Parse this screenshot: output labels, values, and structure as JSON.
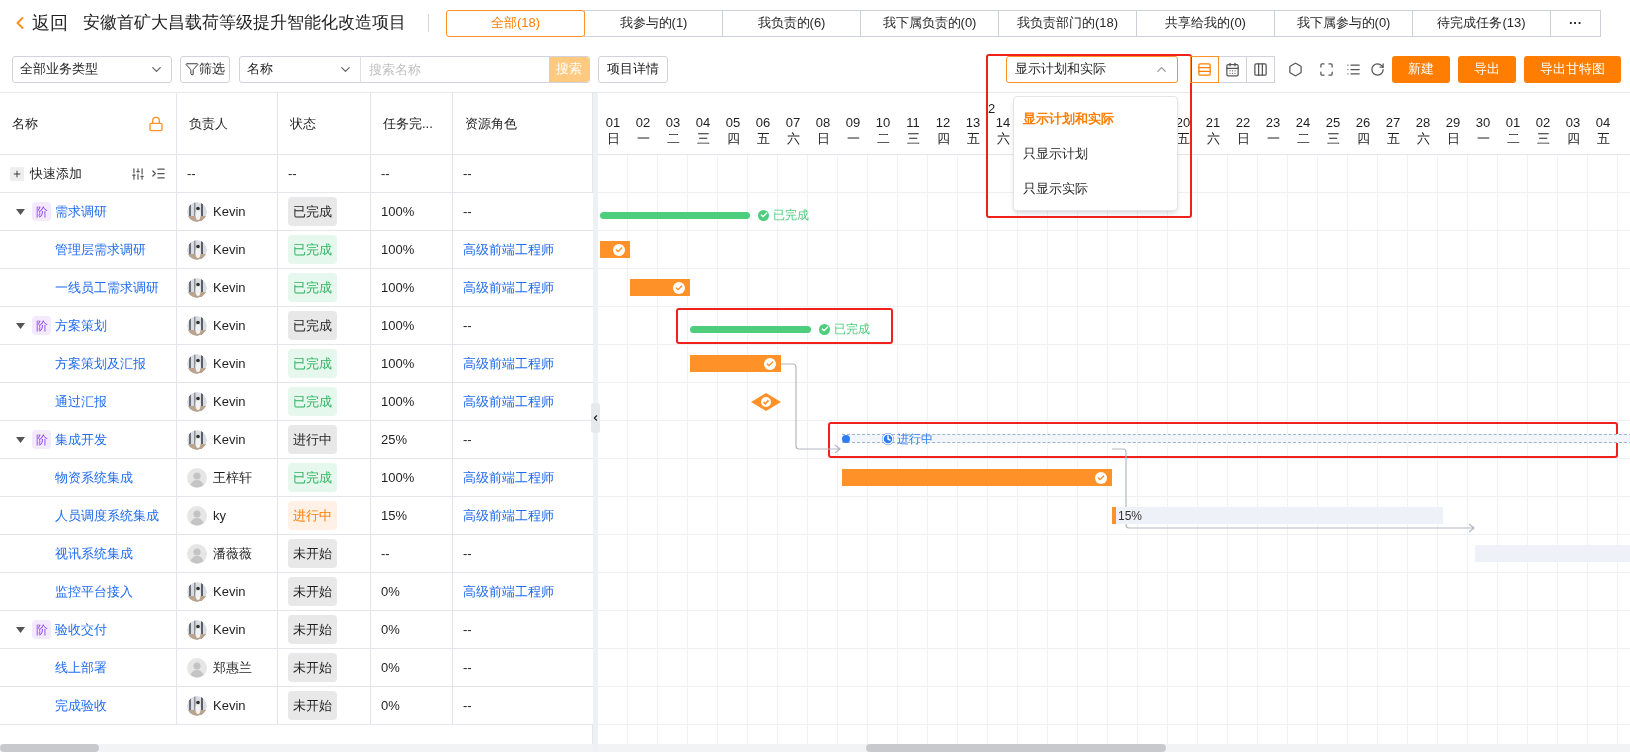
{
  "header": {
    "back": "返回",
    "title": "安徽首矿大昌载荷等级提升智能化改造项目",
    "tabs": [
      {
        "label": "全部(18)",
        "selected": true
      },
      {
        "label": "我参与的(1)",
        "selected": false
      },
      {
        "label": "我负责的(6)",
        "selected": false
      },
      {
        "label": "我下属负责的(0)",
        "selected": false
      },
      {
        "label": "我负责部门的(18)",
        "selected": false
      },
      {
        "label": "共享给我的(0)",
        "selected": false
      },
      {
        "label": "我下属参与的(0)",
        "selected": false
      },
      {
        "label": "待完成任务(13)",
        "selected": false
      },
      {
        "label": "···",
        "selected": false
      }
    ]
  },
  "toolbar": {
    "type_select": "全部业务类型",
    "filter": "筛选",
    "search_field_select": "名称",
    "search_placeholder": "搜索名称",
    "search_button": "搜索",
    "details": "项目详情",
    "view_select": {
      "value": "显示计划和实际",
      "expanded": true,
      "highlighted": true,
      "options": [
        {
          "label": "显示计划和实际",
          "selected": true
        },
        {
          "label": "只显示计划",
          "selected": false
        },
        {
          "label": "只显示实际",
          "selected": false
        }
      ]
    },
    "view_modes": [
      {
        "kind": "gantt",
        "selected": true
      },
      {
        "kind": "calendar",
        "selected": false
      },
      {
        "kind": "board",
        "selected": false
      }
    ],
    "actions": [
      "新建",
      "导出",
      "导出甘特图"
    ]
  },
  "table": {
    "columns": [
      "名称",
      "负责人",
      "状态",
      "任务完...",
      "资源角色"
    ],
    "quick_add": {
      "label": "快速添加",
      "cells": [
        "--",
        "--",
        "--",
        "--"
      ]
    },
    "rows": [
      {
        "kind": "phase",
        "expanded": true,
        "tag": "阶",
        "name": "需求调研",
        "owner": {
          "name": "Kevin"
        },
        "status": {
          "label": "已完成",
          "kind": "neutral"
        },
        "progress": "100%",
        "role": "--",
        "role_link": false
      },
      {
        "kind": "task",
        "name": "管理层需求调研",
        "owner": {
          "name": "Kevin"
        },
        "status": {
          "label": "已完成",
          "kind": "success"
        },
        "progress": "100%",
        "role": "高级前端工程师",
        "role_link": true
      },
      {
        "kind": "task",
        "name": "一线员工需求调研",
        "owner": {
          "name": "Kevin"
        },
        "status": {
          "label": "已完成",
          "kind": "success"
        },
        "progress": "100%",
        "role": "高级前端工程师",
        "role_link": true
      },
      {
        "kind": "phase",
        "expanded": true,
        "tag": "阶",
        "name": "方案策划",
        "owner": {
          "name": "Kevin"
        },
        "status": {
          "label": "已完成",
          "kind": "neutral"
        },
        "progress": "100%",
        "role": "--",
        "role_link": false
      },
      {
        "kind": "task",
        "name": "方案策划及汇报",
        "owner": {
          "name": "Kevin"
        },
        "status": {
          "label": "已完成",
          "kind": "success"
        },
        "progress": "100%",
        "role": "高级前端工程师",
        "role_link": true
      },
      {
        "kind": "task",
        "name": "通过汇报",
        "owner": {
          "name": "Kevin"
        },
        "status": {
          "label": "已完成",
          "kind": "success"
        },
        "progress": "100%",
        "role": "高级前端工程师",
        "role_link": true
      },
      {
        "kind": "phase",
        "expanded": true,
        "tag": "阶",
        "name": "集成开发",
        "owner": {
          "name": "Kevin"
        },
        "status": {
          "label": "进行中",
          "kind": "neutral"
        },
        "progress": "25%",
        "role": "--",
        "role_link": false
      },
      {
        "kind": "task",
        "name": "物资系统集成",
        "owner": {
          "name": "王梓轩",
          "kind": "default"
        },
        "status": {
          "label": "已完成",
          "kind": "success"
        },
        "progress": "100%",
        "role": "高级前端工程师",
        "role_link": true
      },
      {
        "kind": "task",
        "name": "人员调度系统集成",
        "owner": {
          "name": "ky",
          "kind": "default"
        },
        "status": {
          "label": "进行中",
          "kind": "warning"
        },
        "progress": "15%",
        "role": "高级前端工程师",
        "role_link": true
      },
      {
        "kind": "task",
        "name": "视讯系统集成",
        "owner": {
          "name": "潘薇薇",
          "kind": "default"
        },
        "status": {
          "label": "未开始",
          "kind": "neutral"
        },
        "progress": "--",
        "role": "--",
        "role_link": false
      },
      {
        "kind": "task",
        "name": "监控平台接入",
        "owner": {
          "name": "Kevin"
        },
        "status": {
          "label": "未开始",
          "kind": "neutral"
        },
        "progress": "0%",
        "role": "高级前端工程师",
        "role_link": true
      },
      {
        "kind": "phase",
        "expanded": true,
        "tag": "阶",
        "name": "验收交付",
        "owner": {
          "name": "Kevin"
        },
        "status": {
          "label": "未开始",
          "kind": "neutral"
        },
        "progress": "0%",
        "role": "--",
        "role_link": false
      },
      {
        "kind": "task",
        "name": "线上部署",
        "owner": {
          "name": "郑惠兰",
          "kind": "default"
        },
        "status": {
          "label": "未开始",
          "kind": "neutral"
        },
        "progress": "0%",
        "role": "--",
        "role_link": false
      },
      {
        "kind": "task",
        "name": "完成验收",
        "owner": {
          "name": "Kevin"
        },
        "status": {
          "label": "未开始",
          "kind": "neutral"
        },
        "progress": "0%",
        "role": "--",
        "role_link": false
      }
    ]
  },
  "gantt": {
    "month_label": "2",
    "days": [
      {
        "day": "01",
        "weekday": "日"
      },
      {
        "day": "02",
        "weekday": "一"
      },
      {
        "day": "03",
        "weekday": "二"
      },
      {
        "day": "04",
        "weekday": "三"
      },
      {
        "day": "05",
        "weekday": "四"
      },
      {
        "day": "06",
        "weekday": "五"
      },
      {
        "day": "07",
        "weekday": "六"
      },
      {
        "day": "08",
        "weekday": "日"
      },
      {
        "day": "09",
        "weekday": "一"
      },
      {
        "day": "10",
        "weekday": "二"
      },
      {
        "day": "11",
        "weekday": "三"
      },
      {
        "day": "12",
        "weekday": "四"
      },
      {
        "day": "13",
        "weekday": "五"
      },
      {
        "day": "14",
        "weekday": "六"
      },
      {
        "day": "20",
        "weekday": "五"
      },
      {
        "day": "21",
        "weekday": "六"
      },
      {
        "day": "22",
        "weekday": "日"
      },
      {
        "day": "23",
        "weekday": "一"
      },
      {
        "day": "24",
        "weekday": "二"
      },
      {
        "day": "25",
        "weekday": "三"
      },
      {
        "day": "26",
        "weekday": "四"
      },
      {
        "day": "27",
        "weekday": "五"
      },
      {
        "day": "28",
        "weekday": "六"
      },
      {
        "day": "29",
        "weekday": "日"
      },
      {
        "day": "30",
        "weekday": "一"
      },
      {
        "day": "01",
        "weekday": "二"
      },
      {
        "day": "02",
        "weekday": "三"
      },
      {
        "day": "03",
        "weekday": "四"
      },
      {
        "day": "04",
        "weekday": "五"
      }
    ],
    "bars": [
      {
        "kind": "summary_done",
        "label": "已完成",
        "highlighted": false
      },
      {
        "kind": "task_done",
        "highlighted": false
      },
      {
        "kind": "task_done",
        "highlighted": false
      },
      {
        "kind": "summary_done",
        "label": "已完成",
        "highlighted": true
      },
      {
        "kind": "task_done",
        "highlighted": false
      },
      {
        "kind": "milestone",
        "highlighted": false
      },
      {
        "kind": "summary_progress",
        "label": "进行中",
        "highlighted": true
      },
      {
        "kind": "task_done",
        "highlighted": false
      },
      {
        "kind": "task_progress",
        "label": "15%",
        "highlighted": false
      },
      {
        "kind": "task_planned",
        "highlighted": false
      }
    ]
  }
}
